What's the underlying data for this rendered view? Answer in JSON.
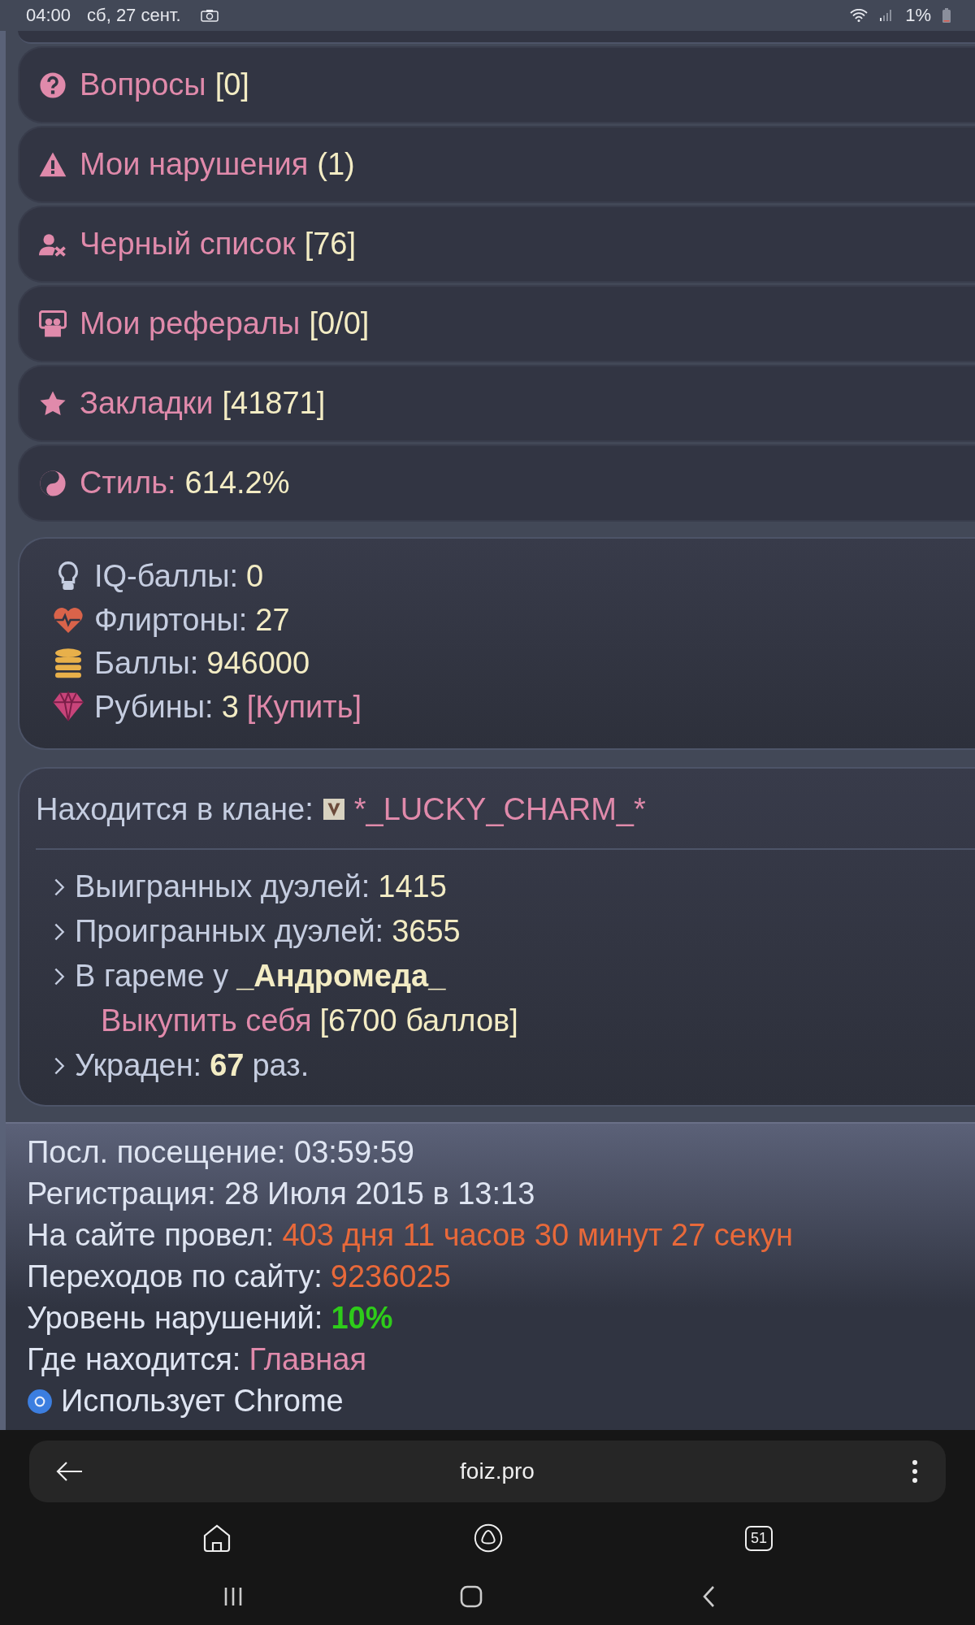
{
  "status_bar": {
    "time": "04:00",
    "date": "сб, 27 сент.",
    "battery": "1%"
  },
  "menu_items": [
    {
      "label": "Вопросы",
      "count": "[0]"
    },
    {
      "label": "Мои нарушения",
      "count": "(1)"
    },
    {
      "label": "Черный список",
      "count": "[76]"
    },
    {
      "label": "Мои рефералы",
      "count": "[0/0]"
    },
    {
      "label": "Закладки",
      "count": "[41871]"
    },
    {
      "label": "Стиль:",
      "count": "614.2%"
    }
  ],
  "stats": [
    {
      "label": "IQ-баллы:",
      "value": "0"
    },
    {
      "label": "Флиртоны:",
      "value": "27"
    },
    {
      "label": "Баллы:",
      "value": "946000"
    },
    {
      "label": "Рубины:",
      "value": "3",
      "link": "[Купить]"
    }
  ],
  "clan": {
    "label": "Находится в клане:",
    "name": "*_LUCKY_CHARM_*"
  },
  "clan_facts": [
    {
      "label": "Выигранных дуэлей:",
      "value": "1415",
      "bold": false
    },
    {
      "label": "Проигранных дуэлей:",
      "value": "3655",
      "bold": false
    },
    {
      "label": "В гареме у",
      "value": "_Андромеда_",
      "bold": true,
      "link": "Выкупить себя",
      "price": "[6700 баллов]"
    },
    {
      "label": "Украден:",
      "value": "67",
      "bold": true,
      "suffix": "раз."
    }
  ],
  "info": [
    {
      "label": "Посл. посещение: 03:59:59"
    },
    {
      "label": "Регистрация: 28 Июля 2015 в 13:13"
    },
    {
      "label": "На сайте провел:",
      "value": "403 дня 11 часов 30 минут 27 секун",
      "color": "#e8693a",
      "bold": false
    },
    {
      "label": "Переходов по сайту:",
      "value": "9236025",
      "color": "#e8693a",
      "bold": false
    },
    {
      "label": "Уровень нарушений:",
      "value": "10%",
      "color": "#2ecc1a",
      "bold": true
    },
    {
      "label": "Где находится:",
      "value": "Главная",
      "color": "#e08aab",
      "bold": false
    },
    {
      "label": "Использует Chrome",
      "kind": "browser"
    }
  ],
  "browser_bar": {
    "url": "foiz.pro",
    "tab_count": "51"
  }
}
